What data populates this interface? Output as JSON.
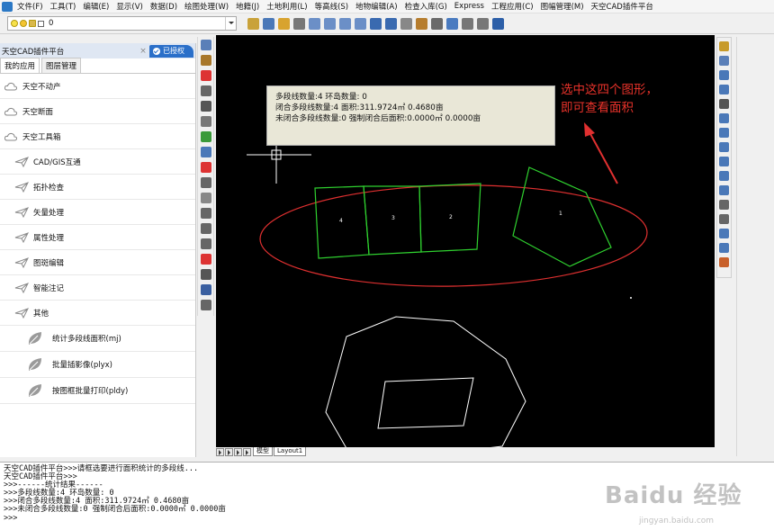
{
  "menu": [
    "文件(F)",
    "工具(T)",
    "编辑(E)",
    "显示(V)",
    "数据(D)",
    "绘图处理(W)",
    "地籍(J)",
    "土地利用(L)",
    "等高线(S)",
    "地物编辑(A)",
    "检查入库(G)",
    "Express",
    "工程应用(C)",
    "图幅管理(M)",
    "天空CAD插件平台"
  ],
  "toolbar": {
    "layer_value": "0"
  },
  "panel": {
    "title": "天空CAD插件平台",
    "close": "×",
    "auth": "已授权",
    "tabs": [
      "我的应用",
      "图层管理"
    ],
    "items": [
      {
        "label": "天空不动产",
        "level": 1
      },
      {
        "label": "天空断面",
        "level": 1
      },
      {
        "label": "天空工具箱",
        "level": 1
      },
      {
        "label": "CAD/GIS互通",
        "level": 2
      },
      {
        "label": "拓扑检查",
        "level": 2
      },
      {
        "label": "矢量处理",
        "level": 2
      },
      {
        "label": "属性处理",
        "level": 2
      },
      {
        "label": "图斑编辑",
        "level": 2
      },
      {
        "label": "智能注记",
        "level": 2
      },
      {
        "label": "其他",
        "level": 2
      },
      {
        "label": "统计多段线面积(mj)",
        "level": 3
      },
      {
        "label": "批量插影像(plyx)",
        "level": 3
      },
      {
        "label": "按图框批量打印(pldy)",
        "level": 3
      }
    ]
  },
  "canvas": {
    "tooltip": [
      "多段线数量:4 环岛数量: 0",
      "闭合多段线数量:4  面积:311.9724㎡  0.4680亩",
      "未闭合多段线数量:0  强制闭合后面积:0.0000㎡  0.0000亩"
    ],
    "annotation": [
      "选中这四个图形，",
      "即可查看面积"
    ],
    "shape_labels": [
      "4",
      "3",
      "2",
      "1"
    ],
    "colors": {
      "polygon": "#2fd12f",
      "ellipse": "#e03030",
      "outline": "#ffffff",
      "background": "#000000"
    }
  },
  "layout_tabs": [
    "模型",
    "Layout1"
  ],
  "command_lines": [
    "天空CAD插件平台>>>请框选要进行面积统计的多段线...",
    "天空CAD插件平台>>>",
    ">>>------统计结果------",
    ">>>多段线数量:4 环岛数量: 0",
    ">>>闭合多段线数量:4  面积:311.9724㎡  0.4680亩",
    ">>>未闭合多段线数量:0  强制闭合后面积:0.0000㎡  0.0000亩",
    ">>>"
  ],
  "watermark": "Baidu 经验",
  "watermark_sub": "jingyan.baidu.com"
}
